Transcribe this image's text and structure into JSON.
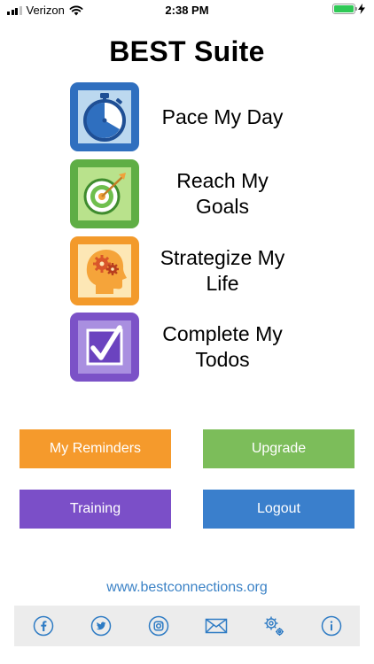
{
  "status_bar": {
    "carrier": "Verizon",
    "time": "2:38 PM"
  },
  "app": {
    "title": "BEST Suite"
  },
  "menu": [
    {
      "label": "Pace My Day",
      "icon": "stopwatch-icon",
      "color": "#2f6fbf"
    },
    {
      "label": "Reach My Goals",
      "icon": "target-icon",
      "color": "#5fae45"
    },
    {
      "label": "Strategize My Life",
      "icon": "head-gears-icon",
      "color": "#f39a2b"
    },
    {
      "label": "Complete My Todos",
      "icon": "checkbox-icon",
      "color": "#7b52c7"
    }
  ],
  "buttons": {
    "reminders": {
      "label": "My Reminders",
      "color": "#f59a2c"
    },
    "upgrade": {
      "label": "Upgrade",
      "color": "#7cbd5a"
    },
    "training": {
      "label": "Training",
      "color": "#7b4fc8"
    },
    "logout": {
      "label": "Logout",
      "color": "#3a7fcc"
    }
  },
  "website": "www.bestconnections.org",
  "footer": {
    "icons": [
      "facebook-icon",
      "twitter-icon",
      "instagram-icon",
      "mail-icon",
      "settings-icon",
      "info-icon"
    ],
    "accent": "#2e7bc4"
  }
}
